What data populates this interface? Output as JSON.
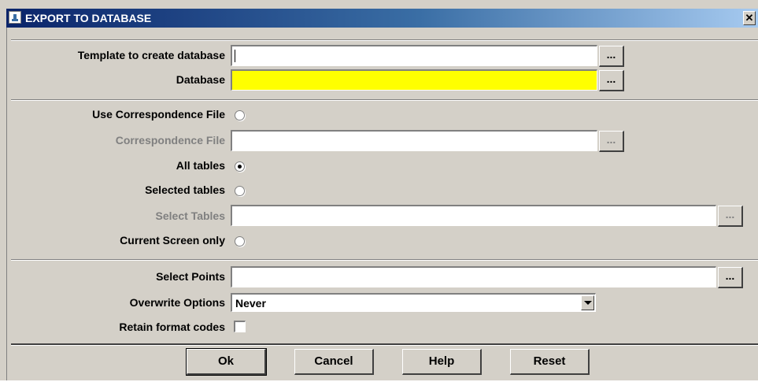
{
  "window": {
    "title": "EXPORT TO DATABASE",
    "close_glyph": "✕"
  },
  "sections": {
    "database": {
      "template_label": "Template to create database",
      "template_value": "",
      "template_browse": "...",
      "database_label": "Database",
      "database_value": "",
      "database_browse": "..."
    },
    "tables": {
      "use_corr_label": "Use Correspondence File",
      "corr_file_label": "Correspondence File",
      "corr_file_value": "",
      "corr_file_browse": "...",
      "all_tables_label": "All tables",
      "selected_tables_label": "Selected tables",
      "select_tables_label": "Select Tables",
      "select_tables_value": "",
      "select_tables_browse": "...",
      "current_screen_label": "Current Screen only",
      "selected_option": "All tables"
    },
    "options": {
      "select_points_label": "Select Points",
      "select_points_value": "",
      "select_points_browse": "...",
      "overwrite_label": "Overwrite Options",
      "overwrite_value": "Never",
      "retain_label": "Retain format codes",
      "retain_checked": false
    }
  },
  "buttons": {
    "ok": "Ok",
    "cancel": "Cancel",
    "help": "Help",
    "reset": "Reset"
  },
  "colors": {
    "database_field": "#ffff00",
    "face": "#d4d0c8",
    "title_start": "#0a246a"
  }
}
